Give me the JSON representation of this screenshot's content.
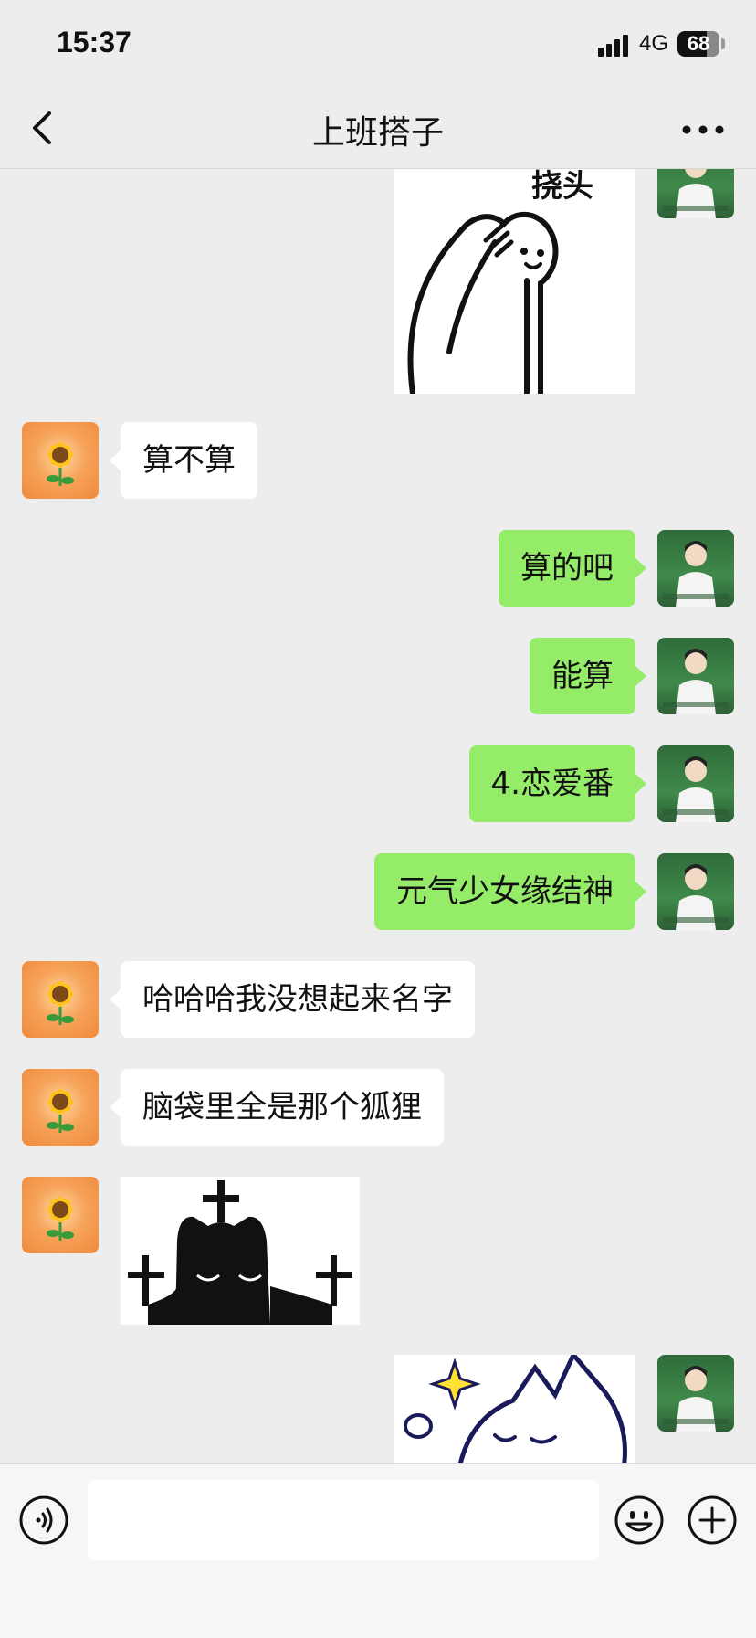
{
  "status_bar": {
    "time": "15:37",
    "network": "4G",
    "battery": "68",
    "signal_icon": "signal-bars-icon"
  },
  "header": {
    "title": "上班搭子",
    "back_icon": "chevron-left-icon",
    "more_icon": "more-dots-icon"
  },
  "messages": [
    {
      "sender": "me",
      "type": "sticker",
      "caption": "挠头"
    },
    {
      "sender": "them",
      "type": "text",
      "text": "算不算"
    },
    {
      "sender": "me",
      "type": "text",
      "text": "算的吧"
    },
    {
      "sender": "me",
      "type": "text",
      "text": "能算"
    },
    {
      "sender": "me",
      "type": "text",
      "text": "4.恋爱番"
    },
    {
      "sender": "me",
      "type": "text",
      "text": "元气少女缘结神"
    },
    {
      "sender": "them",
      "type": "text",
      "text": "哈哈哈我没想起来名字"
    },
    {
      "sender": "them",
      "type": "text",
      "text": "脑袋里全是那个狐狸"
    },
    {
      "sender": "them",
      "type": "sticker"
    },
    {
      "sender": "me",
      "type": "sticker"
    }
  ],
  "input_bar": {
    "voice_icon": "voice-icon",
    "text_value": "",
    "emoji_icon": "emoji-icon",
    "plus_icon": "plus-icon"
  },
  "colors": {
    "background": "#ededed",
    "my_bubble": "#95ec69",
    "their_bubble": "#ffffff"
  }
}
